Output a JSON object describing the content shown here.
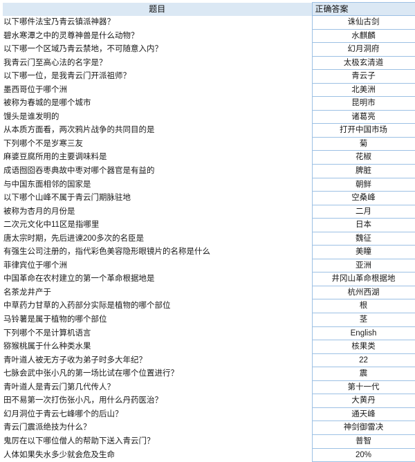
{
  "table": {
    "headers": {
      "question": "题目",
      "answer": "正确答案"
    },
    "rows": [
      {
        "question": "以下哪件法宝乃青云镇派神器？",
        "answer": "诛仙古剑"
      },
      {
        "question": "碧水寒潭之中的灵尊神兽是什么动物？",
        "answer": "水麒麟"
      },
      {
        "question": "以下哪一个区域乃青云禁地，不可随意入内？",
        "answer": "幻月洞府"
      },
      {
        "question": "我青云门至高心法的名字是？",
        "answer": "太极玄清道"
      },
      {
        "question": "以下哪一位，是我青云门开派祖师？",
        "answer": "青云子"
      },
      {
        "question": "墨西哥位于哪个洲",
        "answer": "北美洲"
      },
      {
        "question": "被称为春城的是哪个城市",
        "answer": "昆明市"
      },
      {
        "question": "馒头是谁发明的",
        "answer": "诸葛亮"
      },
      {
        "question": "从本质方面看，两次鸦片战争的共同目的是",
        "answer": "打开中国市场"
      },
      {
        "question": "下列哪个不是岁寒三友",
        "answer": "菊"
      },
      {
        "question": "麻婆豆腐所用的主要调味料是",
        "answer": "花椒"
      },
      {
        "question": "成语囫囵吞枣典故中枣对哪个器官是有益的",
        "answer": "脾脏"
      },
      {
        "question": "与中国东面相邻的国家是",
        "answer": "朝鲜"
      },
      {
        "question": "以下哪个山峰不属于青云门期脉驻地",
        "answer": "空桑峰"
      },
      {
        "question": "被称为杏月的月份是",
        "answer": "二月"
      },
      {
        "question": "二次元文化中11区是指哪里",
        "answer": "日本"
      },
      {
        "question": "唐太宗时期，先后进谏200多次的名臣是",
        "answer": "魏征"
      },
      {
        "question": "有强生公司注册的，指代彩色美容隐形眼镜片的名称是什么",
        "answer": "美瞳"
      },
      {
        "question": "菲律宾位于哪个洲",
        "answer": "亚洲"
      },
      {
        "question": "中国革命在农村建立的第一个革命根据地是",
        "answer": "井冈山革命根据地"
      },
      {
        "question": "名茶龙井产于",
        "answer": "杭州西湖"
      },
      {
        "question": "中草药力甘草的入药部分实际是植物的哪个部位",
        "answer": "根"
      },
      {
        "question": "马铃薯是属于植物的哪个部位",
        "answer": "茎"
      },
      {
        "question": "下列哪个不是计算机语言",
        "answer": "English"
      },
      {
        "question": "猕猴桃属于什么种类水果",
        "answer": "核果类"
      },
      {
        "question": "青叶道人被无方子收为弟子时多大年纪？",
        "answer": "22"
      },
      {
        "question": "七脉会武中张小凡的第一场比试在哪个位置进行？",
        "answer": "震"
      },
      {
        "question": "青叶道人是青云门第几代传人？",
        "answer": "第十一代"
      },
      {
        "question": "田不易第一次打伤张小凡，用什么丹药医治？",
        "answer": "大黄丹"
      },
      {
        "question": "幻月洞位于青云七峰哪个的后山？",
        "answer": "通天峰"
      },
      {
        "question": "青云门震派绝技为什么？",
        "answer": "神剑御雷决"
      },
      {
        "question": "鬼厉在以下哪位僧人的帮助下送入青云门？",
        "answer": "普智"
      },
      {
        "question": "人体如果失水多少就会危及生命",
        "answer": "20%"
      }
    ]
  },
  "colors": {
    "header_background": "#dbe8f4",
    "cell_border": "#9cc0e4",
    "text": "#1a1a1a",
    "page_background": "#ffffff"
  }
}
